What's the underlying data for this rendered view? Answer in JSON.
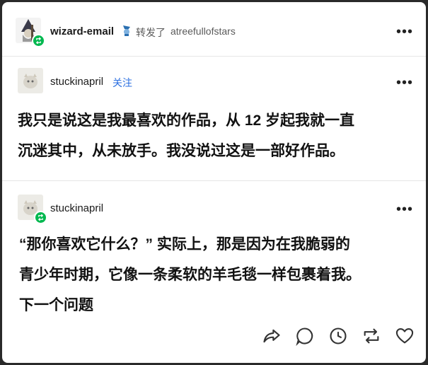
{
  "header": {
    "reblogger": "wizard-email",
    "reblog_label": "转发了",
    "source": "atreefullofstars"
  },
  "first_post": {
    "author": "stuckinapril",
    "follow_label": "关注",
    "line1": "我只是说这是我最喜欢的作品，从 12 岁起我就一直",
    "line2": "沉迷其中，从未放手。我没说过这是一部好作品。"
  },
  "second_post": {
    "author": "stuckinapril",
    "line1": "“那你喜欢它什么？” 实际上，那是因为在我脆弱的",
    "line2": "青少年时期，它像一条柔软的羊毛毯一样包裹着我。",
    "line3": "下一个问题"
  },
  "more_menu": "•••",
  "footer_icons": [
    "share-icon",
    "reply-icon",
    "clock-icon",
    "reblog-icon",
    "heart-icon"
  ],
  "colors": {
    "accent_green": "#00b84f",
    "follow_blue": "#2b6fe0"
  }
}
